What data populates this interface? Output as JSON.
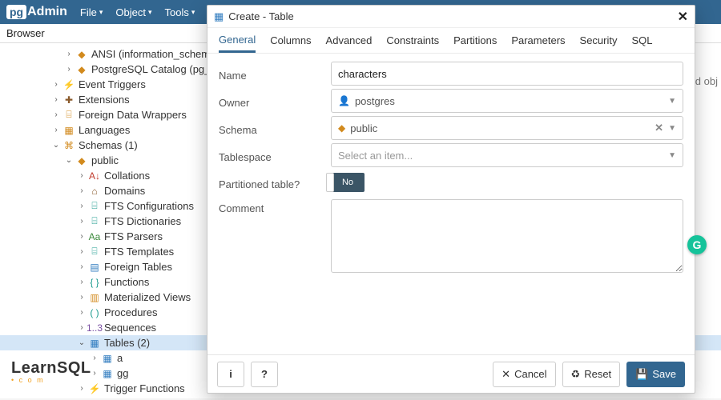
{
  "app": {
    "logo_prefix": "pg",
    "logo_suffix": "Admin"
  },
  "menu": {
    "file": "File",
    "object": "Object",
    "tools": "Tools"
  },
  "browser": {
    "header": "Browser"
  },
  "tree": [
    {
      "indent": 5,
      "exp": "›",
      "icon": "◆",
      "iconCls": "c-orange",
      "label": "ANSI (information_schema)"
    },
    {
      "indent": 5,
      "exp": "›",
      "icon": "◆",
      "iconCls": "c-orange",
      "label": "PostgreSQL Catalog (pg_catalog)"
    },
    {
      "indent": 4,
      "exp": "›",
      "icon": "⚡",
      "iconCls": "c-teal",
      "label": "Event Triggers"
    },
    {
      "indent": 4,
      "exp": "›",
      "icon": "✚",
      "iconCls": "c-brown",
      "label": "Extensions"
    },
    {
      "indent": 4,
      "exp": "›",
      "icon": "⌸",
      "iconCls": "c-orange",
      "label": "Foreign Data Wrappers"
    },
    {
      "indent": 4,
      "exp": "›",
      "icon": "▦",
      "iconCls": "c-orange",
      "label": "Languages"
    },
    {
      "indent": 4,
      "exp": "⌄",
      "icon": "⌘",
      "iconCls": "c-orange",
      "label": "Schemas (1)"
    },
    {
      "indent": 5,
      "exp": "⌄",
      "icon": "◆",
      "iconCls": "c-orange",
      "label": "public"
    },
    {
      "indent": 6,
      "exp": "›",
      "icon": "A↓",
      "iconCls": "c-red",
      "label": "Collations"
    },
    {
      "indent": 6,
      "exp": "›",
      "icon": "⌂",
      "iconCls": "c-brown",
      "label": "Domains"
    },
    {
      "indent": 6,
      "exp": "›",
      "icon": "⌸",
      "iconCls": "c-teal",
      "label": "FTS Configurations"
    },
    {
      "indent": 6,
      "exp": "›",
      "icon": "⌸",
      "iconCls": "c-teal",
      "label": "FTS Dictionaries"
    },
    {
      "indent": 6,
      "exp": "›",
      "icon": "Aa",
      "iconCls": "c-green",
      "label": "FTS Parsers"
    },
    {
      "indent": 6,
      "exp": "›",
      "icon": "⌸",
      "iconCls": "c-teal",
      "label": "FTS Templates"
    },
    {
      "indent": 6,
      "exp": "›",
      "icon": "▤",
      "iconCls": "c-blue",
      "label": "Foreign Tables"
    },
    {
      "indent": 6,
      "exp": "›",
      "icon": "{ }",
      "iconCls": "c-teal",
      "label": "Functions"
    },
    {
      "indent": 6,
      "exp": "›",
      "icon": "▥",
      "iconCls": "c-orange",
      "label": "Materialized Views"
    },
    {
      "indent": 6,
      "exp": "›",
      "icon": "( )",
      "iconCls": "c-teal",
      "label": "Procedures"
    },
    {
      "indent": 6,
      "exp": "›",
      "icon": "1..3",
      "iconCls": "c-purple",
      "label": "Sequences"
    },
    {
      "indent": 6,
      "exp": "⌄",
      "icon": "▦",
      "iconCls": "c-blue",
      "label": "Tables (2)",
      "selected": true
    },
    {
      "indent": 7,
      "exp": "›",
      "icon": "▦",
      "iconCls": "c-blue",
      "label": "a"
    },
    {
      "indent": 7,
      "exp": "›",
      "icon": "▦",
      "iconCls": "c-blue",
      "label": "gg"
    },
    {
      "indent": 6,
      "exp": "›",
      "icon": "⚡",
      "iconCls": "c-teal",
      "label": "Trigger Functions"
    }
  ],
  "dialog": {
    "title": "Create - Table",
    "tabs": [
      "General",
      "Columns",
      "Advanced",
      "Constraints",
      "Partitions",
      "Parameters",
      "Security",
      "SQL"
    ],
    "active_tab": 0,
    "form": {
      "name_label": "Name",
      "name_value": "characters",
      "owner_label": "Owner",
      "owner_value": "postgres",
      "schema_label": "Schema",
      "schema_value": "public",
      "tablespace_label": "Tablespace",
      "tablespace_placeholder": "Select an item...",
      "part_label": "Partitioned table?",
      "part_value": "No",
      "comment_label": "Comment",
      "comment_value": ""
    },
    "footer": {
      "info": "i",
      "help": "?",
      "cancel": "Cancel",
      "reset": "Reset",
      "save": "Save"
    }
  },
  "overlay": {
    "grammarly": "G",
    "watermark": "LearnSQL",
    "watermark_sub": "• c o m"
  },
  "truncated_right": "ed obj"
}
